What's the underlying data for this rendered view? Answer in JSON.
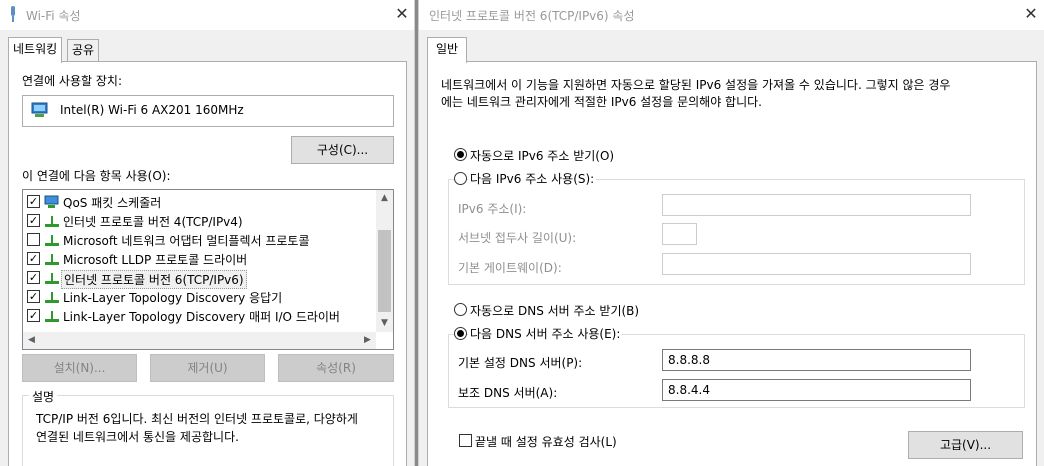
{
  "wifi_dialog": {
    "title": "Wi-Fi 속성",
    "tabs": [
      {
        "label": "네트워킹"
      },
      {
        "label": "공유"
      }
    ],
    "connect_using_label": "연결에 사용할 장치:",
    "adapter_name": "Intel(R) Wi-Fi 6 AX201 160MHz",
    "configure_button": "구성(C)...",
    "items_label": "이 연결에 다음 항목 사용(O):",
    "items": [
      {
        "label": "QoS 패킷 스케줄러",
        "checked": "true",
        "icon": "network-client-icon"
      },
      {
        "label": "인터넷 프로토콜 버전 4(TCP/IPv4)",
        "checked": "true",
        "icon": "protocol-icon"
      },
      {
        "label": "Microsoft 네트워크 어댑터 멀티플렉서 프로토콜",
        "checked": "false",
        "icon": "protocol-icon"
      },
      {
        "label": "Microsoft LLDP 프로토콜 드라이버",
        "checked": "true",
        "icon": "protocol-icon"
      },
      {
        "label": "인터넷 프로토콜 버전 6(TCP/IPv6)",
        "checked": "true",
        "icon": "protocol-icon"
      },
      {
        "label": "Link-Layer Topology Discovery 응답기",
        "checked": "true",
        "icon": "protocol-icon"
      },
      {
        "label": "Link-Layer Topology Discovery 매퍼 I/O 드라이버",
        "checked": "true",
        "icon": "protocol-icon"
      }
    ],
    "install_button": "설치(N)...",
    "uninstall_button": "제거(U)",
    "properties_button": "속성(R)",
    "description_title": "설명",
    "description_text_line1": "TCP/IP 버전 6입니다. 최신 버전의 인터넷 프로토콜로, 다양하게",
    "description_text_line2": "연결된 네트워크에서 통신을 제공합니다."
  },
  "ipv6_dialog": {
    "title": "인터넷 프로토콜 버전 6(TCP/IPv6) 속성",
    "tab": "일반",
    "intro_line1": "네트워크에서 이 기능을 지원하면 자동으로 할당된 IPv6 설정을 가져올 수 있습니다. 그렇지 않은 경우",
    "intro_line2": "에는 네트워크 관리자에게 적절한 IPv6 설정을 문의해야 합니다.",
    "auto_ip_radio": "자동으로 IPv6 주소 받기(O)",
    "manual_ip_radio": "다음 IPv6 주소 사용(S):",
    "ipv6_address_label": "IPv6 주소(I):",
    "prefix_length_label": "서브넷 접두사 길이(U):",
    "gateway_label": "기본 게이트웨이(D):",
    "auto_dns_radio": "자동으로 DNS 서버 주소 받기(B)",
    "manual_dns_radio": "다음 DNS 서버 주소 사용(E):",
    "preferred_dns_label": "기본 설정 DNS 서버(P):",
    "preferred_dns_value": "8.8.8.8",
    "alternate_dns_label": "보조 DNS 서버(A):",
    "alternate_dns_value": "8.8.4.4",
    "validate_checkbox": "끝낼 때 설정 유효성 검사(L)",
    "advanced_button": "고급(V)..."
  },
  "colors": {
    "dialog_bg": "#f0f0f0",
    "selection": "#cce8ff"
  }
}
